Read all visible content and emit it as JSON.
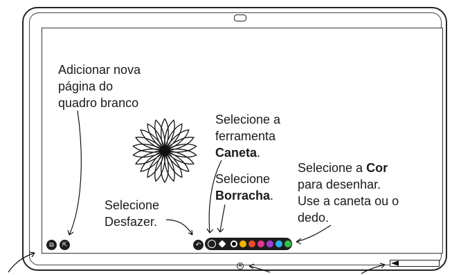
{
  "labels": {
    "add_page": [
      "Adicionar nova",
      "página do",
      "quadro branco"
    ],
    "select_pen_1": "Selecione a",
    "select_pen_2": "ferramenta",
    "select_pen_bold": "Caneta",
    "select_pen_tail": ".",
    "select_eraser_1": "Selecione",
    "select_eraser_bold": "Borracha",
    "select_eraser_tail": ".",
    "select_color_prefix": "Selecione a ",
    "select_color_bold": "Cor",
    "select_color_2": "para desenhar.",
    "select_color_3": "Use a caneta ou o",
    "select_color_4": "dedo.",
    "undo_1": "Selecione",
    "undo_2": "Desfazer."
  },
  "toolbar": {
    "colors": [
      "#000000",
      "#f7b500",
      "#f04b2a",
      "#e6338f",
      "#a43bd6",
      "#2ab3e8",
      "#35c24a"
    ]
  },
  "icons": {
    "undo": "undo-icon",
    "pen": "pen-icon",
    "eraser": "eraser-icon",
    "new_page": "new-page-icon",
    "share": "share-icon",
    "home": "home-button-icon",
    "camera": "camera-icon",
    "stylus": "stylus-icon"
  }
}
